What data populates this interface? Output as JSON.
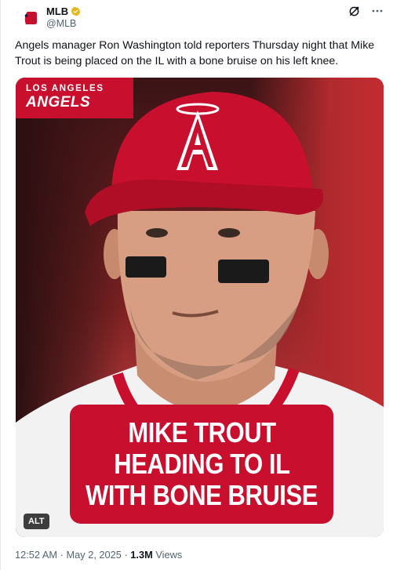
{
  "author": {
    "display_name": "MLB",
    "handle": "@MLB",
    "verified": true,
    "avatar_icon": "mlb-logo",
    "verified_color": "#e2b719"
  },
  "header_actions": [
    "grok-icon",
    "more-icon"
  ],
  "tweet": {
    "text": "Angels manager Ron Washington told reporters Thursday night that Mike Trout is being placed on the IL with a bone bruise on his left knee."
  },
  "media": {
    "team_city": "LOS ANGELES",
    "team_name": "ANGELS",
    "headline_lines": [
      "MIKE TROUT",
      "HEADING TO IL",
      "WITH BONE BRUISE"
    ],
    "alt_label": "ALT",
    "accent_color": "#c8102e"
  },
  "meta": {
    "time": "12:52 AM",
    "separator": "·",
    "date": "May 2, 2025",
    "views_count": "1.3M",
    "views_label": "Views"
  }
}
